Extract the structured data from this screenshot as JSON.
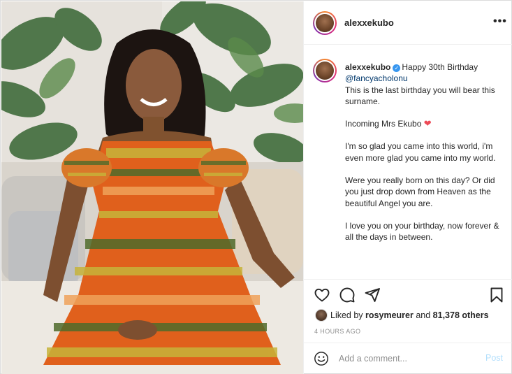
{
  "post": {
    "username": "alexxekubo",
    "more_icon": "more-horizontal-icon"
  },
  "caption": {
    "username": "alexxekubo",
    "verified_icon": "verified-badge-icon",
    "first_text": "Happy 30th Birthday",
    "mention": "@fancyacholonu",
    "lines": [
      "This is the last birthday you will bear this surname.",
      "",
      "Incoming Mrs Ekubo",
      "",
      "I'm so glad you came into this world, i'm even more glad you came into my world.",
      "",
      "Were you really born on this day? Or did you just drop down from Heaven as the beautiful Angel you are.",
      "",
      "I love you on your birthday, now forever & all the days in between."
    ],
    "heart_emoji": "❤️"
  },
  "actions": {
    "like_icon": "heart-icon",
    "comment_icon": "comment-icon",
    "share_icon": "send-icon",
    "save_icon": "bookmark-icon"
  },
  "likes": {
    "prefix": "Liked by",
    "user": "rosymeurer",
    "middle": "and",
    "count": "81,378 others"
  },
  "timestamp": "4 HOURS AGO",
  "comment_box": {
    "placeholder": "Add a comment...",
    "post_label": "Post"
  },
  "colors": {
    "accent_blue": "#3897f0",
    "link_blue": "#00376b",
    "post_disabled": "#b2dffc",
    "heart_red": "#ed4956"
  }
}
